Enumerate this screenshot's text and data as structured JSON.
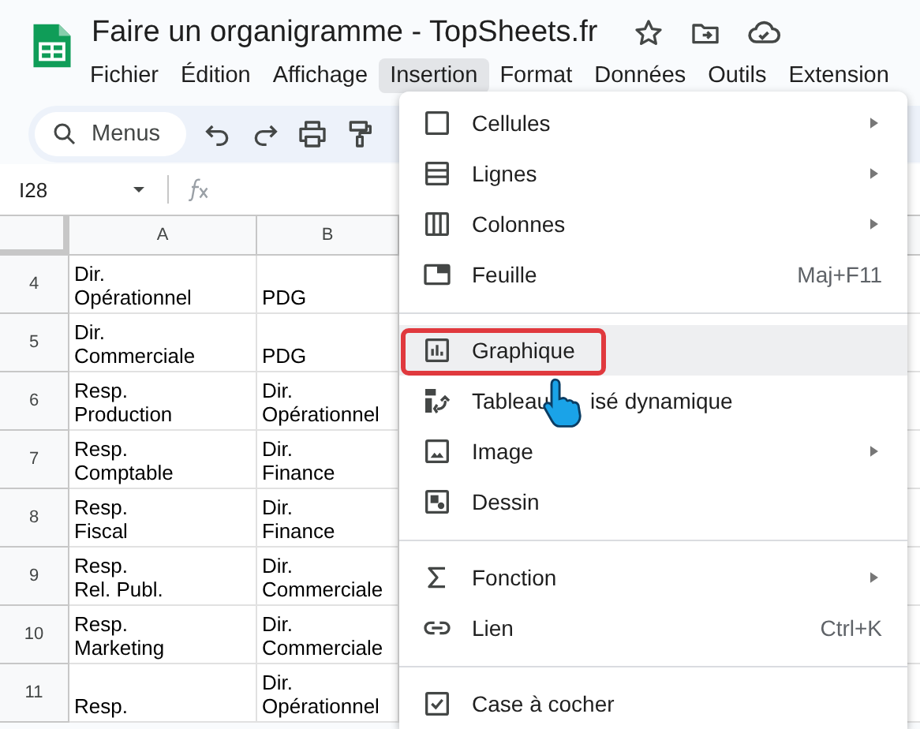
{
  "document": {
    "title": "Faire un organigramme - TopSheets.fr"
  },
  "menubar": [
    {
      "label": "Fichier",
      "selected": false
    },
    {
      "label": "Édition",
      "selected": false
    },
    {
      "label": "Affichage",
      "selected": false
    },
    {
      "label": "Insertion",
      "selected": true
    },
    {
      "label": "Format",
      "selected": false
    },
    {
      "label": "Données",
      "selected": false
    },
    {
      "label": "Outils",
      "selected": false
    },
    {
      "label": "Extension",
      "selected": false
    }
  ],
  "toolbar": {
    "search_label": "Menus"
  },
  "formula_bar": {
    "name_box": "I28"
  },
  "sheet": {
    "columns": [
      "A",
      "B"
    ],
    "rows": [
      {
        "number": "4",
        "cells": [
          "Dir.\nOpérationnel",
          "PDG"
        ]
      },
      {
        "number": "5",
        "cells": [
          "Dir.\nCommerciale",
          "PDG"
        ]
      },
      {
        "number": "6",
        "cells": [
          "Resp.\nProduction",
          "Dir.\nOpérationnel"
        ]
      },
      {
        "number": "7",
        "cells": [
          "Resp.\nComptable",
          "Dir.\nFinance"
        ]
      },
      {
        "number": "8",
        "cells": [
          "Resp.\nFiscal",
          "Dir.\nFinance"
        ]
      },
      {
        "number": "9",
        "cells": [
          "Resp.\nRel. Publ.",
          "Dir.\nCommerciale"
        ]
      },
      {
        "number": "10",
        "cells": [
          "Resp.\nMarketing",
          "Dir.\nCommerciale"
        ]
      },
      {
        "number": "11",
        "cells": [
          "Resp.",
          "Dir.\nOpérationnel"
        ]
      }
    ]
  },
  "insert_menu": {
    "items": [
      {
        "kind": "item",
        "label_parts": [
          "Cellules"
        ],
        "submenu": true,
        "selected": false
      },
      {
        "kind": "item",
        "label_parts": [
          "Lignes"
        ],
        "submenu": true,
        "selected": false
      },
      {
        "kind": "item",
        "label_parts": [
          "Colonnes"
        ],
        "submenu": true,
        "selected": false
      },
      {
        "kind": "item",
        "label_parts": [
          "Feuille"
        ],
        "shortcut": "Maj+F11",
        "selected": false
      },
      {
        "kind": "divider"
      },
      {
        "kind": "item",
        "label_parts": [
          "Graphique"
        ],
        "selected": true
      },
      {
        "kind": "item",
        "label_parts": [
          "Tableau",
          "isé dynamique"
        ],
        "selected": false
      },
      {
        "kind": "item",
        "label_parts": [
          "Image"
        ],
        "submenu": true,
        "selected": false
      },
      {
        "kind": "item",
        "label_parts": [
          "Dessin"
        ],
        "selected": false
      },
      {
        "kind": "divider"
      },
      {
        "kind": "item",
        "label_parts": [
          "Fonction"
        ],
        "submenu": true,
        "selected": false
      },
      {
        "kind": "item",
        "label_parts": [
          "Lien"
        ],
        "shortcut": "Ctrl+K",
        "selected": false
      },
      {
        "kind": "divider"
      },
      {
        "kind": "item",
        "label_parts": [
          "Case à cocher"
        ],
        "selected": false
      }
    ]
  }
}
